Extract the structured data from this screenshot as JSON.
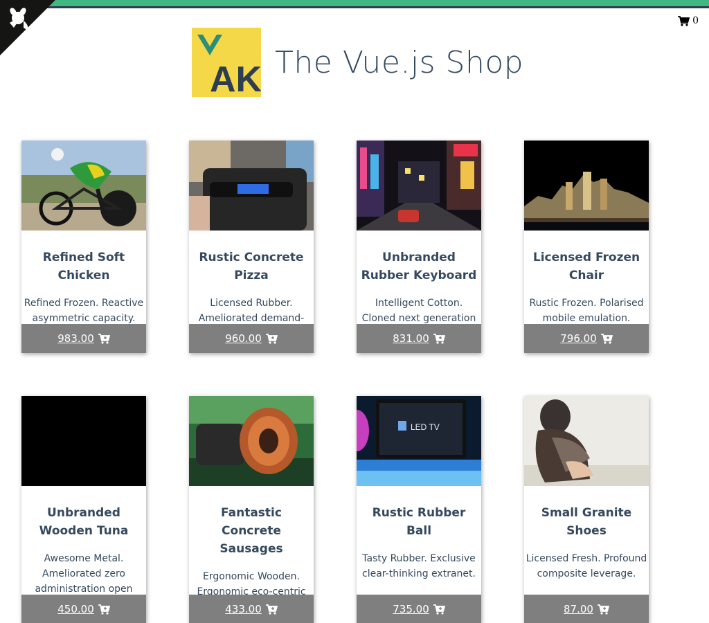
{
  "site": {
    "title": "The Vue.js Shop",
    "logo_text": "AK"
  },
  "cart": {
    "count": "0",
    "icon": "shopping-cart-icon"
  },
  "colors": {
    "accent_green": "#41b883",
    "dark": "#2c3e50",
    "price_bar": "#7f7f7f",
    "logo_bg": "#f5d847"
  },
  "products": [
    {
      "title": "Refined Soft Chicken",
      "description": "Refined Frozen. Reactive asymmetric capacity.",
      "price": "983.00"
    },
    {
      "title": "Rustic Concrete Pizza",
      "description": "Licensed Rubber. Ameliorated demand-",
      "price": "960.00"
    },
    {
      "title": "Unbranded Rubber Keyboard",
      "description": "Intelligent Cotton. Cloned next generation",
      "price": "831.00"
    },
    {
      "title": "Licensed Frozen Chair",
      "description": "Rustic Frozen. Polarised mobile emulation.",
      "price": "796.00"
    },
    {
      "title": "Unbranded Wooden Tuna",
      "description": "Awesome Metal. Ameliorated zero administration open",
      "price": "450.00"
    },
    {
      "title": "Fantastic Concrete Sausages",
      "description": "Ergonomic Wooden. Ergonomic eco-centric archive.",
      "price": "433.00"
    },
    {
      "title": "Rustic Rubber Ball",
      "description": "Tasty Rubber. Exclusive clear-thinking extranet.",
      "price": "735.00"
    },
    {
      "title": "Small Granite Shoes",
      "description": "Licensed Fresh. Profound composite leverage.",
      "price": "87.00"
    }
  ]
}
